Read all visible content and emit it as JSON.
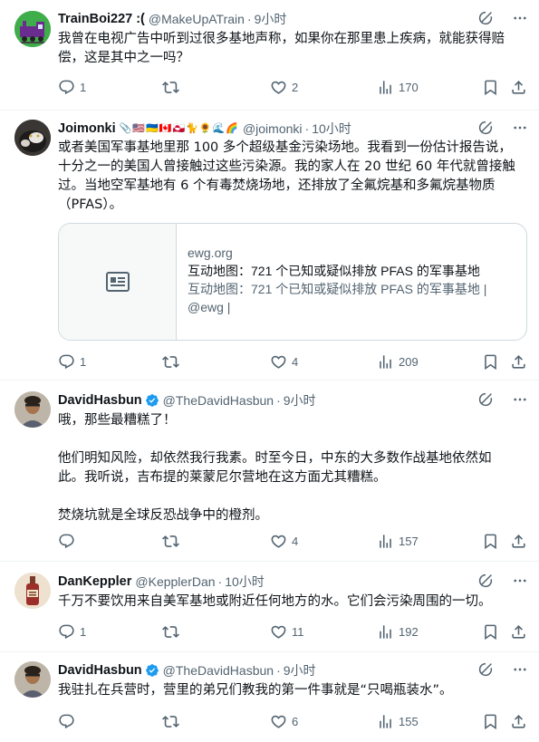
{
  "tweets": [
    {
      "name": "TrainBoi227 :(",
      "handle": "@MakeUpATrain",
      "dot": "·",
      "time": "9小时",
      "lines": [
        "我曾在电视广告中听到过很多基地声称，如果你在那里患上疾病，就能获得赔",
        "偿，这是其中之一吗？"
      ],
      "replies": "1",
      "retweets": "",
      "likes": "2",
      "views": "170"
    },
    {
      "name": "Joimonki",
      "badges": "📎🇺🇸🇺🇦🇨🇦🇬🇱🐈🌻🌊🌈",
      "handle": "@joimonki",
      "dot": "·",
      "time": "10小时",
      "lines": [
        "或者美国军事基地里那 100 多个超级基金污染场地。我看到一份估计报告说，",
        "十分之一的美国人曾接触过这些污染源。我的家人在 20 世纪 60 年代就曾接触",
        "过。当地空军基地有 6 个有毒焚烧场地，还排放了全氟烷基和多氟烷基物质",
        "（PFAS）。"
      ],
      "card": {
        "domain": "ewg.org",
        "title": "互动地图：721 个已知或疑似排放 PFAS 的军事基地",
        "desc_1": "互动地图：721 个已知或疑似排放 PFAS 的军事基地 |",
        "desc_2": "@ewg |"
      },
      "replies": "1",
      "retweets": "",
      "likes": "4",
      "views": "209"
    },
    {
      "name": "DavidHasbun",
      "handle": "@TheDavidHasbun",
      "dot": "·",
      "time": "9小时",
      "lines": [
        "哦，那些最糟糕了！",
        "",
        "他们明知风险，却依然我行我素。时至今日，中东的大多数作战基地依然如",
        "此。我听说，吉布提的莱蒙尼尔营地在这方面尤其糟糕。",
        "",
        "焚烧坑就是全球反恐战争中的橙剂。"
      ],
      "replies": "",
      "retweets": "",
      "likes": "4",
      "views": "157"
    },
    {
      "name": "DanKeppler",
      "handle": "@KepplerDan",
      "dot": "·",
      "time": "10小时",
      "lines": [
        "千万不要饮用来自美军基地或附近任何地方的水。它们会污染周围的一切。"
      ],
      "replies": "1",
      "retweets": "",
      "likes": "11",
      "views": "192"
    },
    {
      "name": "DavidHasbun",
      "handle": "@TheDavidHasbun",
      "dot": "·",
      "time": "9小时",
      "lines": [
        "我驻扎在兵营时，营里的弟兄们教我的第一件事就是“只喝瓶装水”。"
      ],
      "replies": "",
      "retweets": "",
      "likes": "6",
      "views": "155"
    }
  ],
  "colors": {
    "text": "#0f1419",
    "secondary": "#536471",
    "verified": "#1d9bf0",
    "border": "#eff3f4"
  },
  "icons": [
    "grok-icon",
    "more-icon",
    "reply-icon",
    "retweet-icon",
    "like-icon",
    "views-icon",
    "bookmark-icon",
    "share-icon",
    "link-card-icon",
    "verified-badge-icon"
  ]
}
